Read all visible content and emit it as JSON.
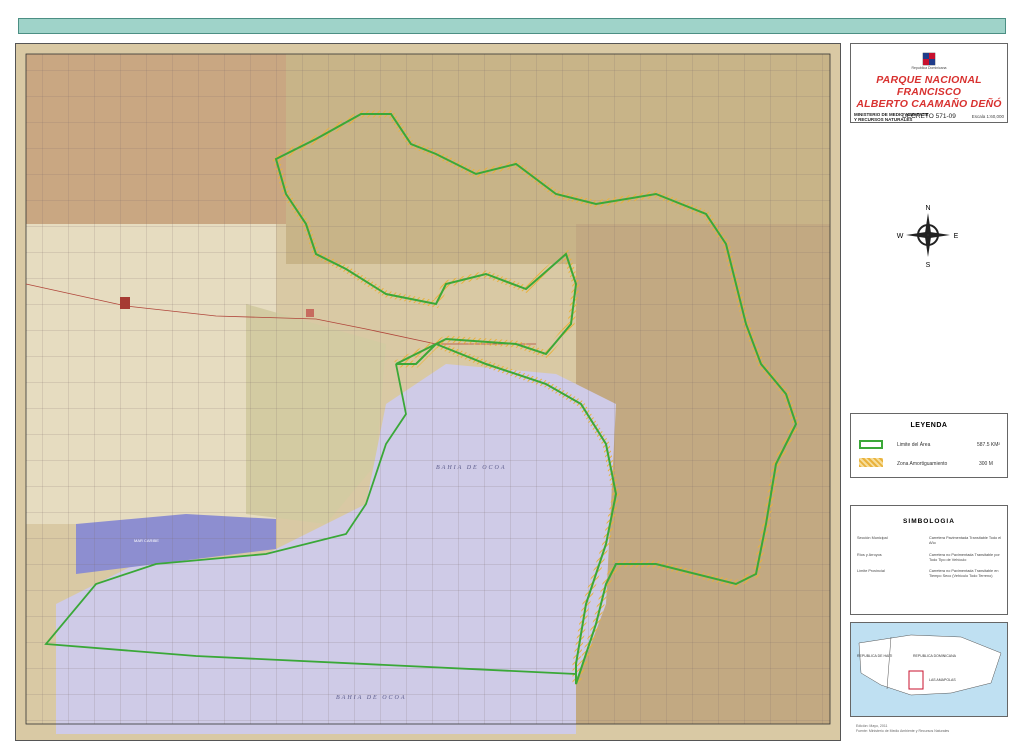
{
  "map": {
    "bay_name": "BAHIA DE OCOA",
    "lagoon_name": "MAR CARIBE"
  },
  "title_block": {
    "seal_caption": "Republica Dominicana",
    "title_line1": "PARQUE NACIONAL FRANCISCO",
    "title_line2": "ALBERTO CAAMAÑO DEÑÓ",
    "decree": "DECRETO 571-09",
    "ministry_line1": "MINISTERIO DE MEDIO AMBIENTE",
    "ministry_line2": "Y RECURSOS NATURALES",
    "scale": "Escala 1:60,000"
  },
  "compass": {
    "n": "N",
    "s": "S",
    "e": "E",
    "w": "W"
  },
  "legend": {
    "title": "LEYENDA",
    "area_label": "Limite del Área",
    "area_value": "587.5 KM²",
    "buffer_label": "Zona Amortiguamiento",
    "buffer_value": "300 M",
    "area_color": "#3aa838",
    "buffer_color": "#e9b23c"
  },
  "symbology": {
    "title": "SIMBOLOGIA",
    "items": [
      "Sección Municipal",
      "Ríos y Arroyos",
      "Límite Provincial",
      "Carretera Pavimentada Transitable Todo el Año",
      "Carretera no Pavimentada Transitable por Todo Tipo de Vehículo",
      "Carretera no Pavimentada Transitable en Tiempo Seco (Vehículo Todo Terreno)"
    ]
  },
  "inset": {
    "label_haiti": "REPUBLICA DE HAITI",
    "label_rd": "REPUBLICA DOMINICANA",
    "label_area": "LAS AMAPOLAS"
  },
  "source": {
    "line1": "Edición: Mayo, 2011",
    "line2": "Fuente: Ministerio de Medio Ambiente y Recursos Naturales"
  }
}
